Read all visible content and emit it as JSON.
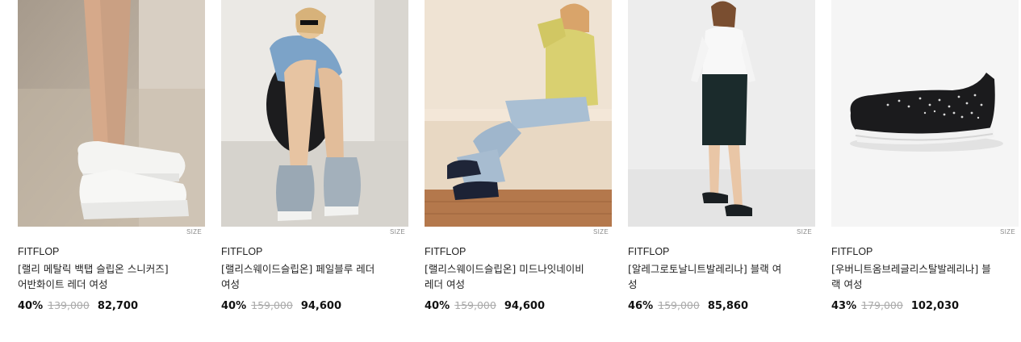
{
  "products": [
    {
      "size_label": "SIZE",
      "brand": "FITFLOP",
      "name": "[랠리 메탈릭 백탭 슬립온 스니커즈] 어반화이트 레더 여성",
      "discount": "40%",
      "original_price": "139,000",
      "sale_price": "82,700",
      "image_subject": "white-leather-slip-on-sneakers-on-feet"
    },
    {
      "size_label": "SIZE",
      "brand": "FITFLOP",
      "name": "[랠리스웨이드슬립온] 페일블루 레더 여성",
      "discount": "40%",
      "original_price": "159,000",
      "sale_price": "94,600",
      "image_subject": "woman-seated-wearing-pale-blue-suede-slip-ons"
    },
    {
      "size_label": "SIZE",
      "brand": "FITFLOP",
      "name": "[랠리스웨이드슬립온] 미드나잇네이비 레더 여성",
      "discount": "40%",
      "original_price": "159,000",
      "sale_price": "94,600",
      "image_subject": "woman-in-yellow-jacket-wearing-navy-slip-ons"
    },
    {
      "size_label": "SIZE",
      "brand": "FITFLOP",
      "name": "[알레그로토날니트발레리나] 블랙 여성",
      "discount": "46%",
      "original_price": "159,000",
      "sale_price": "85,860",
      "image_subject": "woman-standing-wearing-black-knit-ballerinas"
    },
    {
      "size_label": "SIZE",
      "brand": "FITFLOP",
      "name": "[우버니트옴브레글리스탈발레리나] 블랙 여성",
      "discount": "43%",
      "original_price": "179,000",
      "sale_price": "102,030",
      "image_subject": "black-knit-ballerina-shoe-with-crystals"
    }
  ],
  "colors": {
    "text": "#222222",
    "strikethrough": "#aaaaaa",
    "size_label": "#8a8a8a"
  }
}
